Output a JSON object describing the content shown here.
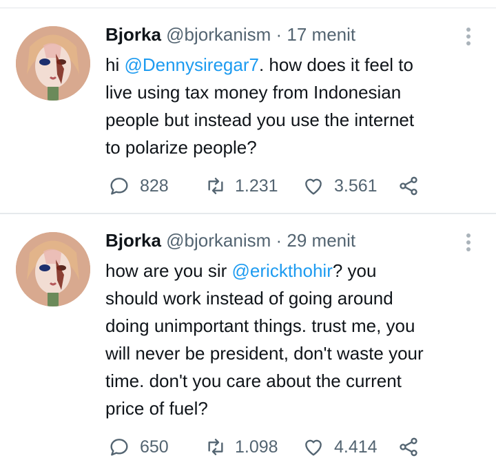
{
  "tweets": [
    {
      "author_name": "Bjorka",
      "handle": "@bjorkanism",
      "separator": "·",
      "time": "17 menit",
      "text_before": "hi ",
      "mention": "@Dennysiregar7",
      "text_after": ". how does it feel to\nlive using tax money from Indonesian\npeople but instead you use the internet\nto polarize people?",
      "replies": "828",
      "retweets": "1.231",
      "likes": "3.561"
    },
    {
      "author_name": "Bjorka",
      "handle": "@bjorkanism",
      "separator": "·",
      "time": "29 menit",
      "text_before": "how are you sir ",
      "mention": "@erickthohir",
      "text_after": "? you\nshould work instead of going around\ndoing unimportant things. trust me, you\nwill never be president, don't waste your\ntime. don't you care about the current\nprice of fuel?",
      "replies": "650",
      "retweets": "1.098",
      "likes": "4.414"
    }
  ],
  "icons": {
    "reply": "reply-icon",
    "retweet": "retweet-icon",
    "like": "like-icon",
    "share": "share-icon",
    "more": "more-options-icon"
  },
  "colors": {
    "text": "#0f1419",
    "secondary": "#536471",
    "mention": "#1d9bf0",
    "divider": "#e6e9ec"
  }
}
